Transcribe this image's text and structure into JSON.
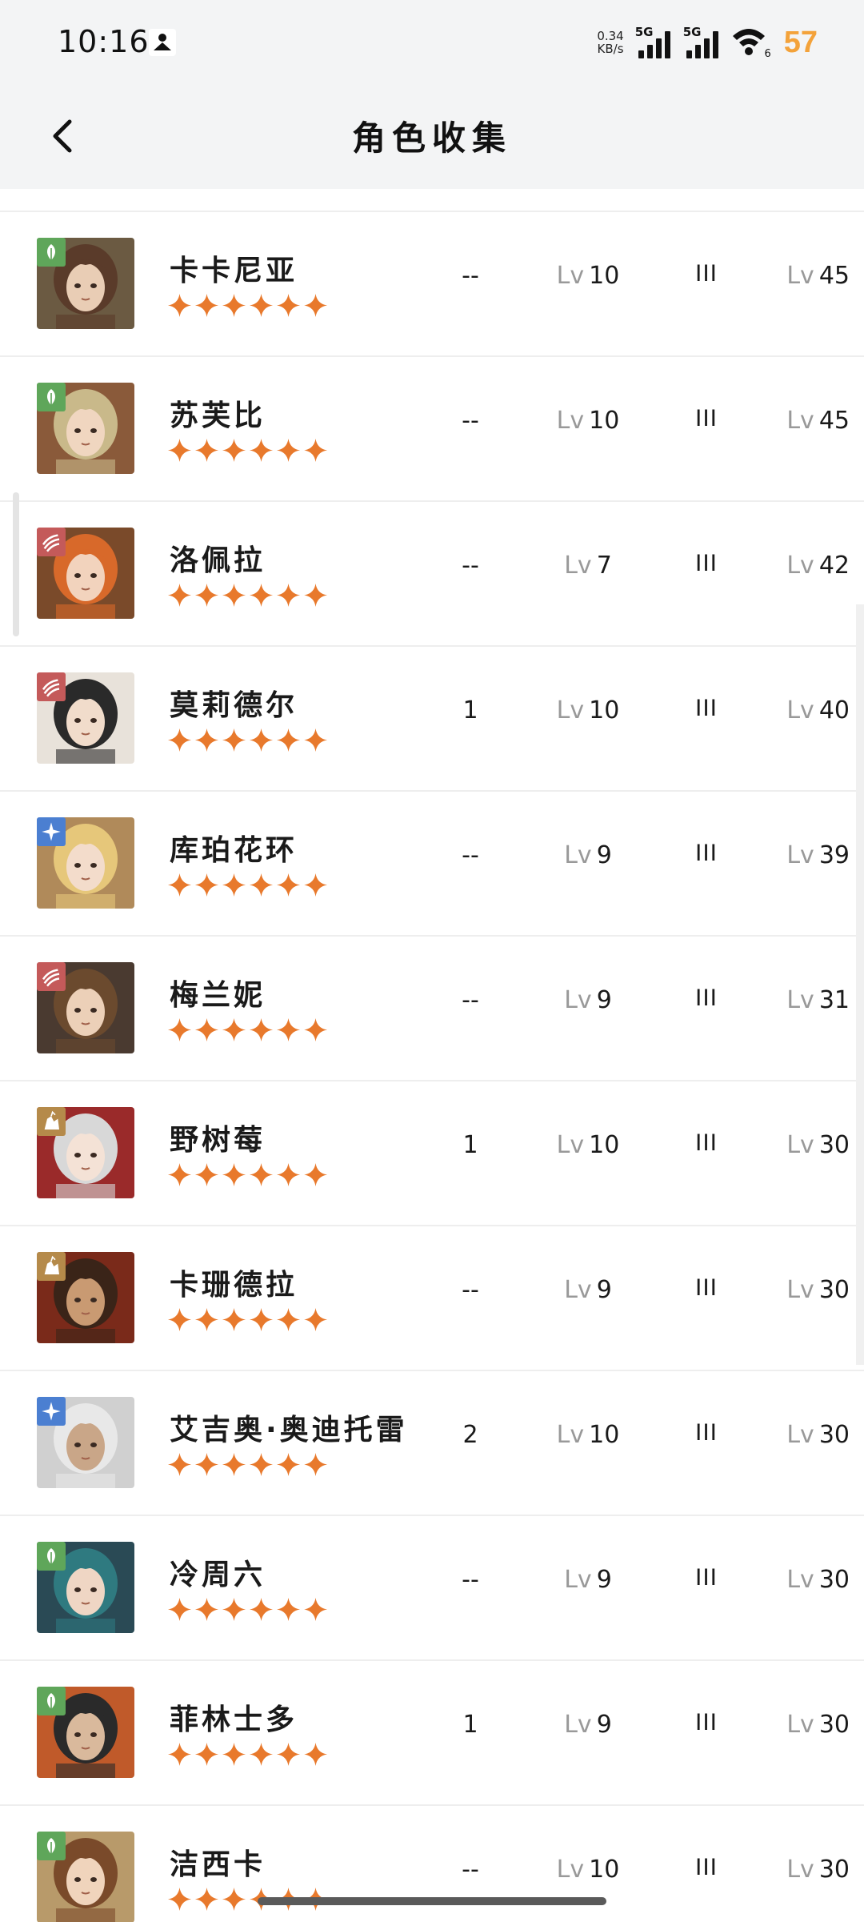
{
  "status_bar": {
    "time": "10:16",
    "net_speed_value": "0.34",
    "net_speed_unit": "KB/s",
    "sim1_tag": "5G",
    "sim2_tag": "5G",
    "wifi_sub": "6",
    "battery": "57",
    "battery_color": "#f3a23a"
  },
  "header": {
    "title": "角色收集"
  },
  "colors": {
    "star": "#e8792c",
    "lv_prefix": "#999999",
    "divider": "#eeeeee"
  },
  "rows": [
    {
      "name": "卡卡尼亚",
      "element": "leaf",
      "element_color": "#5fa65a",
      "stars": 6,
      "col_a": "--",
      "lv_prefix": "Lv",
      "col_b": "10",
      "col_c": "III",
      "col_d": "45",
      "avatar_hair": "#5a3b2a",
      "avatar_skin": "#e9cdb5",
      "avatar_bg": "#6b5a42"
    },
    {
      "name": "苏芙比",
      "element": "leaf",
      "element_color": "#5fa65a",
      "stars": 6,
      "col_a": "--",
      "lv_prefix": "Lv",
      "col_b": "10",
      "col_c": "III",
      "col_d": "45",
      "avatar_hair": "#c9b98a",
      "avatar_skin": "#f0d6c0",
      "avatar_bg": "#8a5a3a"
    },
    {
      "name": "洛佩拉",
      "element": "beast",
      "element_color": "#c45a5a",
      "stars": 6,
      "col_a": "--",
      "lv_prefix": "Lv",
      "col_b": "7",
      "col_c": "III",
      "col_d": "42",
      "avatar_hair": "#d8692a",
      "avatar_skin": "#f2d3bd",
      "avatar_bg": "#7a4a2a"
    },
    {
      "name": "莫莉德尔",
      "element": "beast",
      "element_color": "#c45a5a",
      "stars": 6,
      "col_a": "1",
      "lv_prefix": "Lv",
      "col_b": "10",
      "col_c": "III",
      "col_d": "40",
      "avatar_hair": "#2a2a2a",
      "avatar_skin": "#f1dccb",
      "avatar_bg": "#e8e2da"
    },
    {
      "name": "库珀花环",
      "element": "star",
      "element_color": "#4b7fd1",
      "stars": 6,
      "col_a": "--",
      "lv_prefix": "Lv",
      "col_b": "9",
      "col_c": "III",
      "col_d": "39",
      "avatar_hair": "#e6c77a",
      "avatar_skin": "#f3dccb",
      "avatar_bg": "#b08a5a"
    },
    {
      "name": "梅兰妮",
      "element": "beast",
      "element_color": "#c45a5a",
      "stars": 6,
      "col_a": "--",
      "lv_prefix": "Lv",
      "col_b": "9",
      "col_c": "III",
      "col_d": "31",
      "avatar_hair": "#6b4a2e",
      "avatar_skin": "#ecd0b8",
      "avatar_bg": "#4a3a30"
    },
    {
      "name": "野树莓",
      "element": "mineral",
      "element_color": "#b58a4a",
      "stars": 6,
      "col_a": "1",
      "lv_prefix": "Lv",
      "col_b": "10",
      "col_c": "III",
      "col_d": "30",
      "avatar_hair": "#d8d8d8",
      "avatar_skin": "#f4e2d6",
      "avatar_bg": "#9a2a2a"
    },
    {
      "name": "卡珊德拉",
      "element": "mineral",
      "element_color": "#b58a4a",
      "stars": 6,
      "col_a": "--",
      "lv_prefix": "Lv",
      "col_b": "9",
      "col_c": "III",
      "col_d": "30",
      "avatar_hair": "#3a2418",
      "avatar_skin": "#c99a72",
      "avatar_bg": "#7a2a1a"
    },
    {
      "name": "艾吉奥·奥迪托雷",
      "element": "star",
      "element_color": "#4b7fd1",
      "stars": 6,
      "col_a": "2",
      "lv_prefix": "Lv",
      "col_b": "10",
      "col_c": "III",
      "col_d": "30",
      "avatar_hair": "#e8e8e8",
      "avatar_skin": "#c9a688",
      "avatar_bg": "#d0d0d0"
    },
    {
      "name": "冷周六",
      "element": "leaf",
      "element_color": "#5fa65a",
      "stars": 6,
      "col_a": "--",
      "lv_prefix": "Lv",
      "col_b": "9",
      "col_c": "III",
      "col_d": "30",
      "avatar_hair": "#2f7a80",
      "avatar_skin": "#efd6c4",
      "avatar_bg": "#2a4a55"
    },
    {
      "name": "菲林士多",
      "element": "leaf",
      "element_color": "#5fa65a",
      "stars": 6,
      "col_a": "1",
      "lv_prefix": "Lv",
      "col_b": "9",
      "col_c": "III",
      "col_d": "30",
      "avatar_hair": "#2a2a2a",
      "avatar_skin": "#d9b99c",
      "avatar_bg": "#c05a2a"
    },
    {
      "name": "洁西卡",
      "element": "leaf",
      "element_color": "#5fa65a",
      "stars": 6,
      "col_a": "--",
      "lv_prefix": "Lv",
      "col_b": "10",
      "col_c": "III",
      "col_d": "30",
      "avatar_hair": "#7a4a2a",
      "avatar_skin": "#f0d4bc",
      "avatar_bg": "#b89a6a"
    }
  ]
}
